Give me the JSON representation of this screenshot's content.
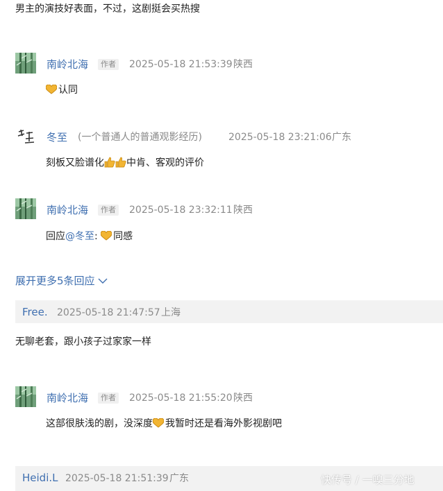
{
  "top_text": "男主的演技好表面，不过，这剧挺会买热搜",
  "replies": [
    {
      "user": "南岭北海",
      "tag": "作者",
      "time": "2025-05-18 21:53:39",
      "location": "陕西",
      "body": "认同"
    },
    {
      "user": "冬至",
      "note": "(一个普通人的普通观影经历)",
      "time": "2025-05-18 23:21:06",
      "location": "广东",
      "body_a": "刻板又脸谱化",
      "body_b": "中肯、客观的评价"
    },
    {
      "user": "南岭北海",
      "tag": "作者",
      "time": "2025-05-18 23:32:11",
      "location": "陕西",
      "reply_prefix": "回应",
      "reply_target": "@冬至",
      "reply_colon": ":",
      "body": "同感"
    }
  ],
  "expand_label": "展开更多5条回应",
  "comment2": {
    "user": "Free.",
    "time": "2025-05-18 21:47:57",
    "location": "上海",
    "body": "无聊老套，跟小孩子过家家一样"
  },
  "reply4": {
    "user": "南岭北海",
    "tag": "作者",
    "time": "2025-05-18 21:55:20",
    "location": "陕西",
    "body_a": "这部很肤浅的剧，没深度",
    "body_b": "我暂时还是看海外影视剧吧"
  },
  "comment3": {
    "user": "Heidi.L",
    "time": "2025-05-18 21:51:39",
    "location": "广东"
  },
  "watermark": "快传号 / 一嗅三分地",
  "colors": {
    "link": "#3f6fb0",
    "meta": "#8a8a8a",
    "bar": "#f2f2f2"
  }
}
